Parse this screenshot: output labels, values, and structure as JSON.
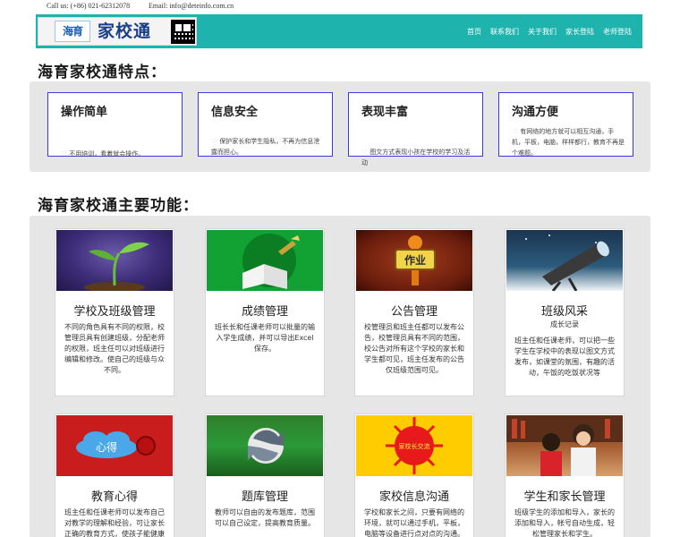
{
  "topbar": {
    "call": "Call us: (+86) 021-62312078",
    "email": "Email: info@deteinfo.com.cn"
  },
  "logo": {
    "mark": "海育",
    "brand": "家校通"
  },
  "nav": [
    "首页",
    "联系我们",
    "关于我们",
    "家长登陆",
    "老师登陆"
  ],
  "features_title": "海育家校通特点：",
  "features": [
    {
      "title": "操作简单",
      "desc": "不用培训，看着就会操作。"
    },
    {
      "title": "信息安全",
      "desc": "保护家长和学生隐私，不再为信息泄露而担心。"
    },
    {
      "title": "表现丰富",
      "desc": "图文方式表现小孩在学校的学习及活动"
    },
    {
      "title": "沟通方便",
      "desc": "有网络的地方就可以相互沟通，手机，平板，电脑，样样都行，教育不再是个难题。"
    }
  ],
  "functions_title": "海育家校通主要功能：",
  "functions": [
    {
      "title": "学校及班级管理",
      "subtitle": "",
      "desc": "不同的角色具有不同的权限，校管理员具有创建班级，分配老师的权限，班主任可以对班级进行编辑和修改。使自己的班级与众不同。",
      "image": "plant-icon"
    },
    {
      "title": "成绩管理",
      "subtitle": "",
      "desc": "班长长和任课老师可以批量的输入学生成绩，并可以导出Excel保存。",
      "image": "book-icon"
    },
    {
      "title": "公告管理",
      "subtitle": "",
      "desc": "校管理员和班主任都可以发布公告，校管理员具有不同的范围，校公告对所有这个学校的家长和学生都可见，班主任发布的公告仅班级范围可见。",
      "image": "homework-board-icon",
      "board_text": "作业"
    },
    {
      "title": "班级风采",
      "subtitle": "成长记录",
      "desc": "班主任和任课老师，可以把一些学生在学校中的表现以图文方式发布，如课堂的氛围，有趣的活动，午饭的吃饭状况等",
      "image": "telescope-icon"
    },
    {
      "title": "教育心得",
      "subtitle": "",
      "desc": "班主任和任课老师可以发布自己对教学的理解和经验，可让家长正确的教育方式，使孩子能健康的成长。",
      "image": "heart-icon",
      "badge_text": "心得"
    },
    {
      "title": "题库管理",
      "subtitle": "",
      "desc": "教师可以自由的发布题库，范围可以自己设定，提高教育质量。",
      "image": "refresh-icon"
    },
    {
      "title": "家校信息沟通",
      "subtitle": "",
      "desc": "学校和家长之间，只要有网络的环境，就可以通过手机，平板，电脑等设备进行点对点的沟通。",
      "image": "sun-icon",
      "badge_text": "家校长交流"
    },
    {
      "title": "学生和家长管理",
      "subtitle": "",
      "desc": "班级学生的添加和导入，家长的添加和导入，帐号自动生成，轻松管理家长和学生。",
      "image": "family-photo"
    }
  ]
}
